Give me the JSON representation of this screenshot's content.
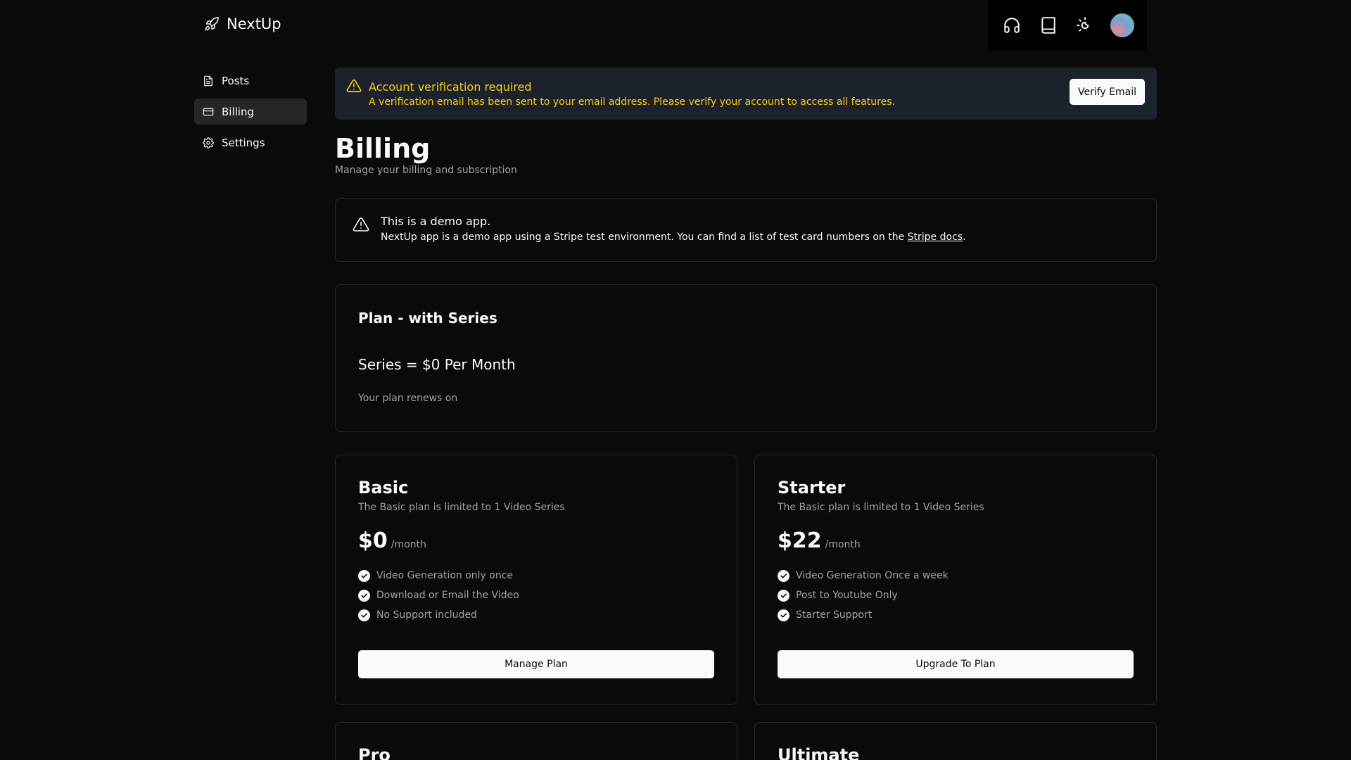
{
  "brand": {
    "name": "NextUp"
  },
  "sidebar": {
    "items": [
      {
        "label": "Posts"
      },
      {
        "label": "Billing"
      },
      {
        "label": "Settings"
      }
    ]
  },
  "alert": {
    "title": "Account verification required",
    "description": "A verification email has been sent to your email address. Please verify your account to access all features.",
    "button": "Verify Email"
  },
  "page": {
    "title": "Billing",
    "subtitle": "Manage your billing and subscription"
  },
  "demo": {
    "title": "This is a demo app.",
    "description": "NextUp app is a demo app using a Stripe test environment. You can find a list of test card numbers on the ",
    "link": "Stripe docs",
    "suffix": "."
  },
  "current_plan": {
    "title": "Plan - with Series",
    "line": "Series = $0 Per Month",
    "renew": "Your plan renews on"
  },
  "plans": [
    {
      "name": "Basic",
      "description": "The Basic plan is limited to 1 Video Series",
      "price": "$0",
      "period": "/month",
      "features": [
        "Video Generation only once",
        "Download or Email the Video",
        "No Support included"
      ],
      "button": "Manage Plan"
    },
    {
      "name": "Starter",
      "description": "The Basic plan is limited to 1 Video Series",
      "price": "$22",
      "period": "/month",
      "features": [
        "Video Generation Once a week",
        "Post to Youtube Only",
        "Starter Support"
      ],
      "button": "Upgrade To Plan"
    },
    {
      "name": "Pro"
    },
    {
      "name": "Ultimate"
    }
  ],
  "colors": {
    "background": "#0a0a0a",
    "alert_bg": "#1c222c",
    "warning": "#facc15",
    "border": "#262626",
    "muted_text": "#a1a1aa"
  }
}
